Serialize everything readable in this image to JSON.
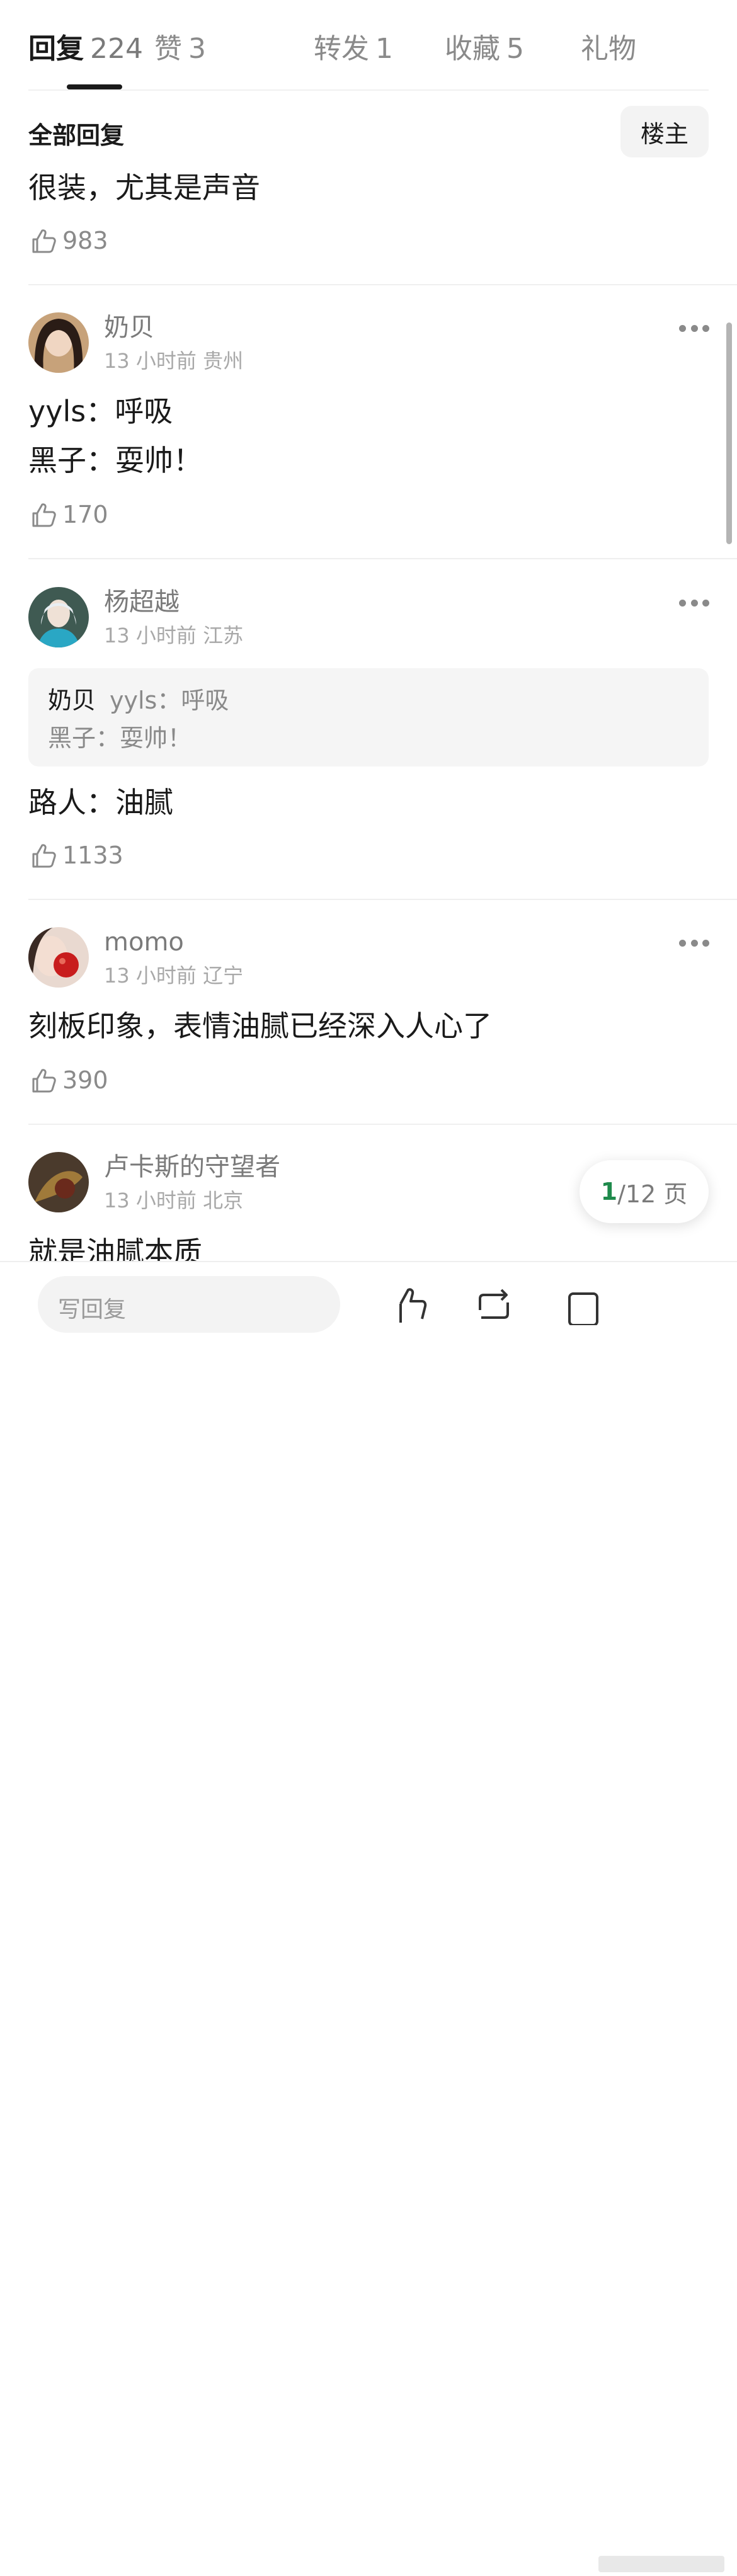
{
  "tabs": [
    {
      "label": "回复",
      "count": "224"
    },
    {
      "label": "赞",
      "count": "3"
    },
    {
      "label": "转发",
      "count": "1"
    },
    {
      "label": "收藏",
      "count": "5"
    },
    {
      "label": "礼物",
      "count": ""
    }
  ],
  "header": {
    "all_replies": "全部回复",
    "owner_filter": "楼主"
  },
  "main_post": {
    "text": "很装，尤其是声音",
    "likes": "983"
  },
  "comments": [
    {
      "user": "奶贝",
      "time": "13 小时前",
      "location": "贵州",
      "lines": [
        "yyls：呼吸",
        "黑子：耍帅！"
      ],
      "likes": "170"
    },
    {
      "user": "杨超越",
      "time": "13 小时前",
      "location": "江苏",
      "quote": {
        "author": "奶贝",
        "line1": "yyls：呼吸",
        "line2": "黑子：耍帅！"
      },
      "lines": [
        "路人：油腻"
      ],
      "likes": "1133"
    },
    {
      "user": "momo",
      "time": "13 小时前",
      "location": "辽宁",
      "lines": [
        "刻板印象，表情油腻已经深入人心了"
      ],
      "likes": "390"
    },
    {
      "user": "卢卡斯的守望者",
      "time": "13 小时前",
      "location": "北京",
      "lines": [
        "就是油腻本质"
      ]
    }
  ],
  "pagination": {
    "current": "1",
    "total": "/12 页"
  },
  "bottom_bar": {
    "reply_placeholder": "写回复"
  },
  "colors": {
    "accent_green": "#1f8a4c",
    "text_primary": "#1a1a1a",
    "text_secondary": "#8a8a8a"
  }
}
